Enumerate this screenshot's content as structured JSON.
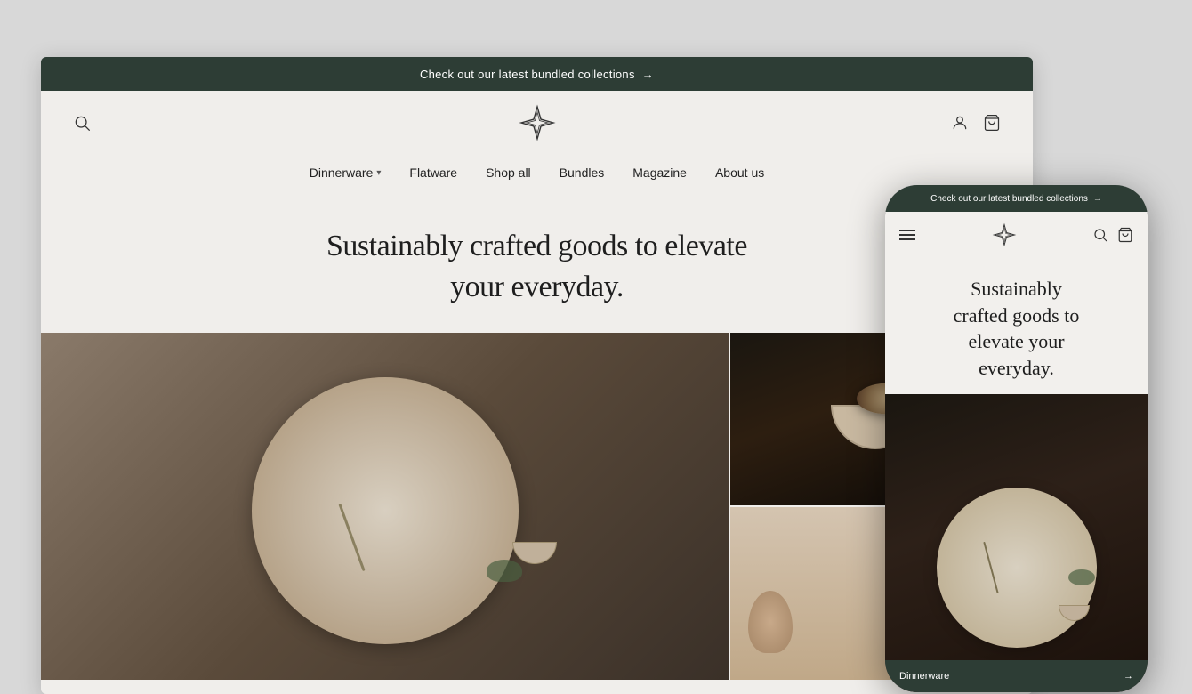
{
  "announcement": {
    "text": "Check out our latest bundled collections",
    "arrow": "→",
    "bg": "#2d3d35"
  },
  "header": {
    "search_label": "Search",
    "user_label": "Log in",
    "cart_label": "Cart"
  },
  "logo": {
    "alt": "Brand star logo"
  },
  "nav": {
    "items": [
      {
        "label": "Dinnerware",
        "hasDropdown": true
      },
      {
        "label": "Flatware"
      },
      {
        "label": "Shop all"
      },
      {
        "label": "Bundles"
      },
      {
        "label": "Magazine"
      },
      {
        "label": "About us"
      }
    ]
  },
  "hero": {
    "title_line1": "Sustainably crafted goods to elevate",
    "title_line2": "your everyday."
  },
  "mobile": {
    "announcement": {
      "text": "Check out our latest bundled collections",
      "arrow": "→"
    },
    "hero": {
      "title": "Sustainably crafted goods to elevate your everyday."
    },
    "bottom_bar": {
      "label": "Dinnerware",
      "arrow": "→"
    }
  }
}
